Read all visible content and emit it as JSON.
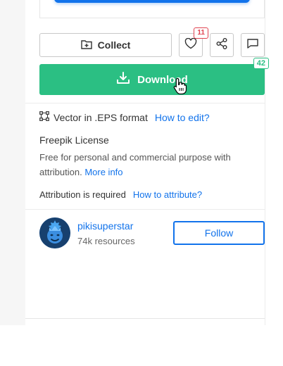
{
  "actions": {
    "collect_label": "Collect",
    "likes_badge": "11"
  },
  "download": {
    "label": "Download",
    "count_badge": "42"
  },
  "format": {
    "text": "Vector in .EPS format",
    "help_link": "How to edit?"
  },
  "license": {
    "title": "Freepik License",
    "description": "Free for personal and commercial purpose with attribution.",
    "more_link": "More info",
    "attribution_text": "Attribution is required",
    "attribution_link": "How to attribute?"
  },
  "author": {
    "name": "pikisuperstar",
    "resources": "74k resources",
    "follow_label": "Follow"
  },
  "colors": {
    "accent_blue": "#1273eb",
    "download_green": "#2bbf83",
    "badge_red": "#e0424f"
  },
  "icons": [
    "folder-plus-icon",
    "heart-icon",
    "share-icon",
    "comment-icon",
    "download-icon",
    "hand-cursor-icon",
    "vector-format-icon"
  ]
}
